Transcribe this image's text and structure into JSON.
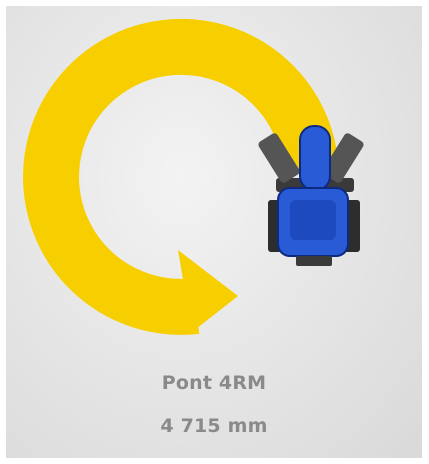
{
  "caption": {
    "title": "Pont 4RM",
    "value": "4 715 mm"
  },
  "colors": {
    "arrow": "#f7ce00",
    "tractor_body": "#2a5bd7",
    "tractor_dark": "#0d2a82",
    "tyre": "#2d2d2d",
    "text": "#8a8a8a"
  },
  "icons": [
    "turning-arrow-icon",
    "tractor-icon"
  ]
}
